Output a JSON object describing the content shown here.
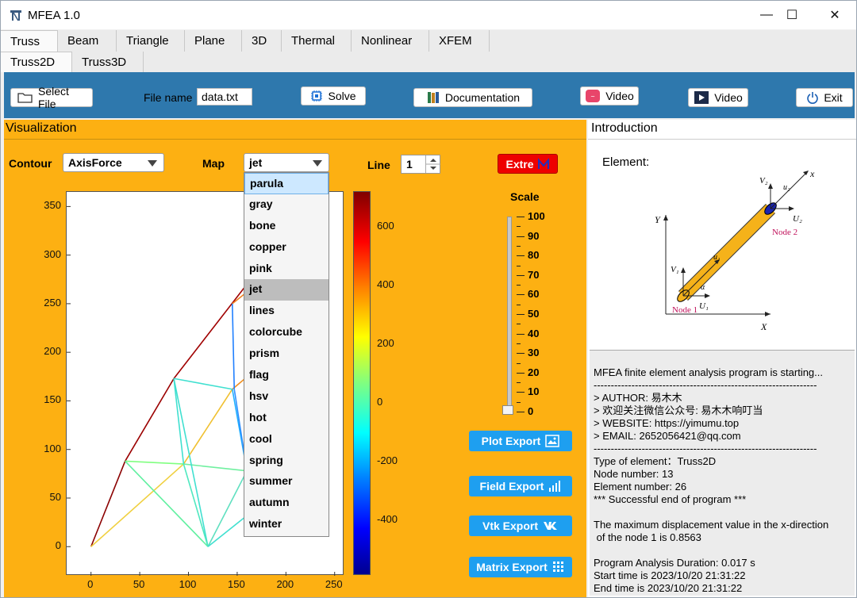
{
  "window": {
    "title": "MFEA 1.0",
    "minimize": "—",
    "maximize": "☐",
    "close": "✕"
  },
  "tabs": [
    "Truss",
    "Beam",
    "Triangle",
    "Plane",
    "3D",
    "Thermal",
    "Nonlinear",
    "XFEM"
  ],
  "subtabs": [
    "Truss2D",
    "Truss3D"
  ],
  "toolbar": {
    "select_file": "Select File",
    "file_name_label": "File name",
    "file_name_value": "data.txt",
    "solve": "Solve",
    "documentation": "Documentation",
    "video1": "Video",
    "video2": "Video",
    "exit": "Exit"
  },
  "visualization": {
    "title": "Visualization",
    "contour_label": "Contour",
    "contour_value": "AxisForce",
    "map_label": "Map",
    "map_value": "jet",
    "map_options": [
      "parula",
      "gray",
      "bone",
      "copper",
      "pink",
      "jet",
      "lines",
      "colorcube",
      "prism",
      "flag",
      "hsv",
      "hot",
      "cool",
      "spring",
      "summer",
      "autumn",
      "winter"
    ],
    "line_label": "Line",
    "line_value": "1",
    "extre_label": "Extre",
    "scale_label": "Scale",
    "scale_ticks": [
      "100",
      "90",
      "80",
      "70",
      "60",
      "50",
      "40",
      "30",
      "20",
      "10",
      "0"
    ],
    "scale_value": 0,
    "colorbar_ticks": [
      "600",
      "400",
      "200",
      "0",
      "-200",
      "-400"
    ],
    "export_buttons": [
      "Plot Export",
      "Field Export",
      "Vtk Export",
      "Matrix Export"
    ]
  },
  "chart_data": {
    "type": "line",
    "title": "",
    "xlabel": "",
    "ylabel": "",
    "xlim": [
      -25,
      260
    ],
    "ylim": [
      -30,
      365
    ],
    "xticks": [
      "0",
      "50",
      "100",
      "150",
      "200",
      "250"
    ],
    "yticks": [
      "0",
      "50",
      "100",
      "150",
      "200",
      "250",
      "300",
      "350"
    ],
    "segments": [
      {
        "x": [
          0,
          35
        ],
        "y": [
          0,
          88
        ],
        "color": "#8b0000"
      },
      {
        "x": [
          35,
          85
        ],
        "y": [
          88,
          173
        ],
        "color": "#9b0000"
      },
      {
        "x": [
          85,
          160
        ],
        "y": [
          173,
          270
        ],
        "color": "#a00000"
      },
      {
        "x": [
          160,
          170
        ],
        "y": [
          270,
          286
        ],
        "color": "#e08020"
      },
      {
        "x": [
          0,
          95
        ],
        "y": [
          0,
          85
        ],
        "color": "#f0d040"
      },
      {
        "x": [
          95,
          145
        ],
        "y": [
          85,
          162
        ],
        "color": "#f0c030"
      },
      {
        "x": [
          145,
          170
        ],
        "y": [
          162,
          183
        ],
        "color": "#f09020"
      },
      {
        "x": [
          145,
          170
        ],
        "y": [
          250,
          270
        ],
        "color": "#f08020"
      },
      {
        "x": [
          35,
          95
        ],
        "y": [
          88,
          85
        ],
        "color": "#80ff80"
      },
      {
        "x": [
          95,
          160
        ],
        "y": [
          85,
          78
        ],
        "color": "#70f0a0"
      },
      {
        "x": [
          85,
          95
        ],
        "y": [
          173,
          85
        ],
        "color": "#40e0d0"
      },
      {
        "x": [
          85,
          145
        ],
        "y": [
          173,
          162
        ],
        "color": "#40e0d0"
      },
      {
        "x": [
          35,
          120
        ],
        "y": [
          88,
          0
        ],
        "color": "#60f0a0"
      },
      {
        "x": [
          85,
          120
        ],
        "y": [
          173,
          0
        ],
        "color": "#40e0d0"
      },
      {
        "x": [
          95,
          120
        ],
        "y": [
          85,
          0
        ],
        "color": "#50e8c0"
      },
      {
        "x": [
          120,
          160
        ],
        "y": [
          0,
          78
        ],
        "color": "#60e0c0"
      },
      {
        "x": [
          145,
          160
        ],
        "y": [
          162,
          78
        ],
        "color": "#20b0ff"
      },
      {
        "x": [
          145,
          147
        ],
        "y": [
          250,
          162
        ],
        "color": "#2080ff"
      },
      {
        "x": [
          147,
          160
        ],
        "y": [
          162,
          78
        ],
        "color": "#3090ff"
      },
      {
        "x": [
          120,
          170
        ],
        "y": [
          0,
          40
        ],
        "color": "#40e0d0"
      }
    ]
  },
  "introduction": {
    "title": "Introduction",
    "element_label": "Element:",
    "diagram_labels": {
      "y_axis": "Y",
      "x_axis": "X",
      "local_x": "x",
      "node1": "Node 1",
      "node2": "Node 2",
      "v1": "V₁",
      "v2": "V₂",
      "u1": "U₁",
      "u2": "U₂",
      "lu1": "u₁",
      "lu2": "u₂",
      "alpha": "α"
    },
    "log_lines": [
      "MFEA finite element analysis program is starting...",
      "-----------------------------------------------------------------",
      "> AUTHOR: 易木木",
      "> 欢迎关注微信公众号: 易木木响叮当",
      "> WEBSITE: https://yimumu.top",
      "> EMAIL: 2652056421@qq.com",
      "-----------------------------------------------------------------",
      "Type of element：Truss2D",
      "Node number: 13",
      "Element number: 26",
      "*** Successful end of program ***",
      "",
      "The maximum displacement value in the x-direction",
      " of the node 1 is 0.8563",
      "",
      "Program Analysis Duration: 0.017 s",
      "Start time is 2023/10/20 21:31:22",
      "End time is 2023/10/20 21:31:22"
    ]
  },
  "colors": {
    "toolbar": "#2e78ad",
    "panel": "#fdb012",
    "button_blue": "#1e9ff0",
    "extre_red": "#ee0000"
  }
}
